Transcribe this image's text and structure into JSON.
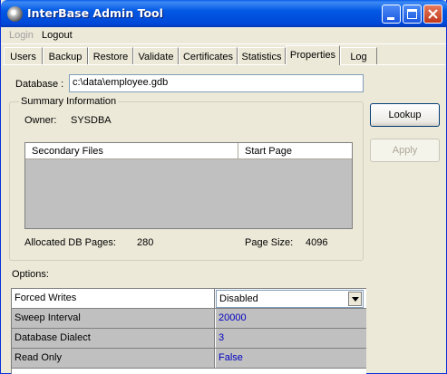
{
  "window": {
    "title": "InterBase Admin Tool"
  },
  "menu": {
    "login": "Login",
    "logout": "Logout"
  },
  "tabs": [
    "Users",
    "Backup",
    "Restore",
    "Validate",
    "Certificates",
    "Statistics",
    "Properties",
    "Log"
  ],
  "active_tab": "Properties",
  "database": {
    "label": "Database :",
    "value": "c:\\data\\employee.gdb"
  },
  "summary": {
    "title": "Summary Information",
    "owner_label": "Owner:",
    "owner_value": "SYSDBA",
    "columns": [
      "Secondary Files",
      "Start Page"
    ],
    "rows": [],
    "allocated_label": "Allocated DB Pages:",
    "allocated_value": "280",
    "pagesize_label": "Page Size:",
    "pagesize_value": "4096"
  },
  "buttons": {
    "lookup": "Lookup",
    "apply": "Apply"
  },
  "options": {
    "label": "Options:",
    "rows": [
      {
        "name": "Forced Writes",
        "value": "Disabled"
      },
      {
        "name": "Sweep Interval",
        "value": "20000"
      },
      {
        "name": "Database Dialect",
        "value": "3"
      },
      {
        "name": "Read Only",
        "value": "False"
      }
    ]
  }
}
